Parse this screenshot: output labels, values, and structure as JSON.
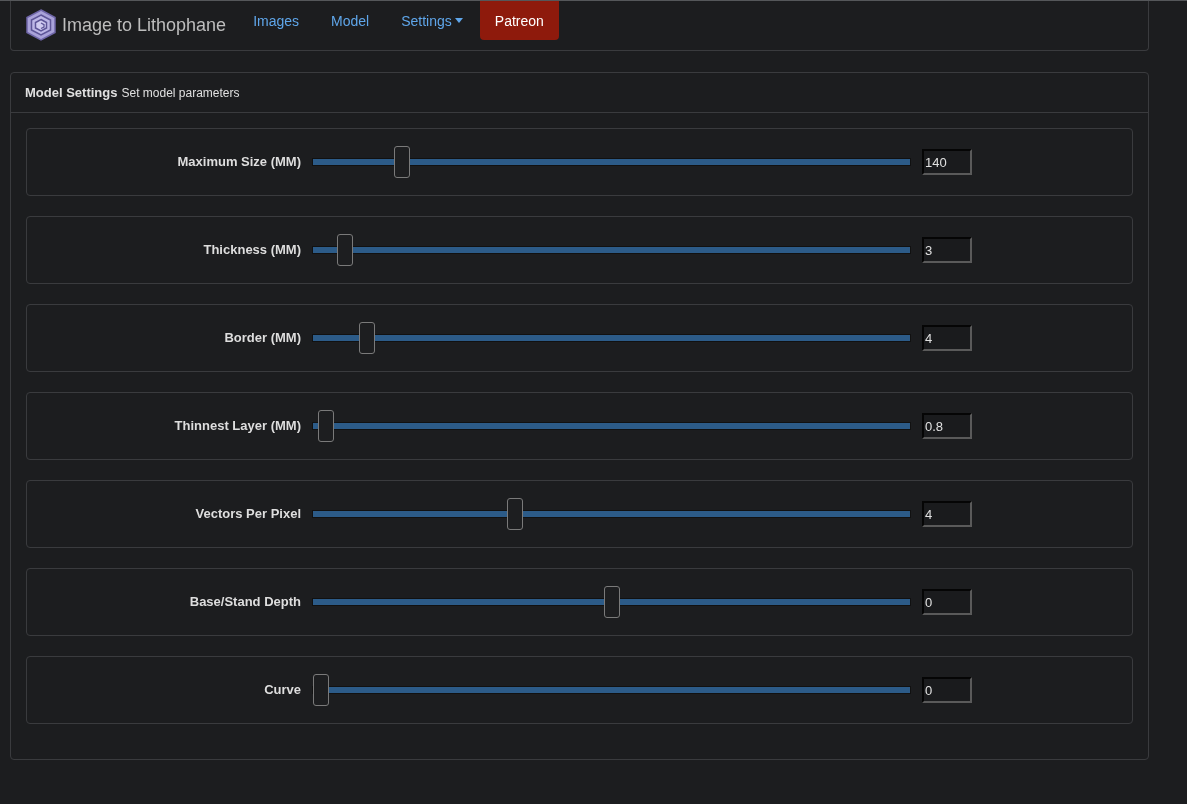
{
  "navbar": {
    "brand": "Image to Lithophane",
    "links": [
      {
        "label": "Images",
        "kind": "link"
      },
      {
        "label": "Model",
        "kind": "link"
      },
      {
        "label": "Settings",
        "kind": "dropdown"
      },
      {
        "label": "Patreon",
        "kind": "button"
      }
    ]
  },
  "panel": {
    "title": "Model Settings",
    "subtitle": "Set model parameters",
    "settings": [
      {
        "label": "Maximum Size (MM)",
        "level": 0.14,
        "value": "140"
      },
      {
        "label": "Thickness (MM)",
        "level": 0.042,
        "value": "3"
      },
      {
        "label": "Border (MM)",
        "level": 0.08,
        "value": "4"
      },
      {
        "label": "Thinnest Layer (MM)",
        "level": 0.009,
        "value": "0.8"
      },
      {
        "label": "Vectors Per Pixel",
        "level": 0.334,
        "value": "4"
      },
      {
        "label": "Base/Stand Depth",
        "level": 0.5,
        "value": "0"
      },
      {
        "label": "Curve",
        "level": 0.0,
        "value": "0"
      }
    ]
  }
}
